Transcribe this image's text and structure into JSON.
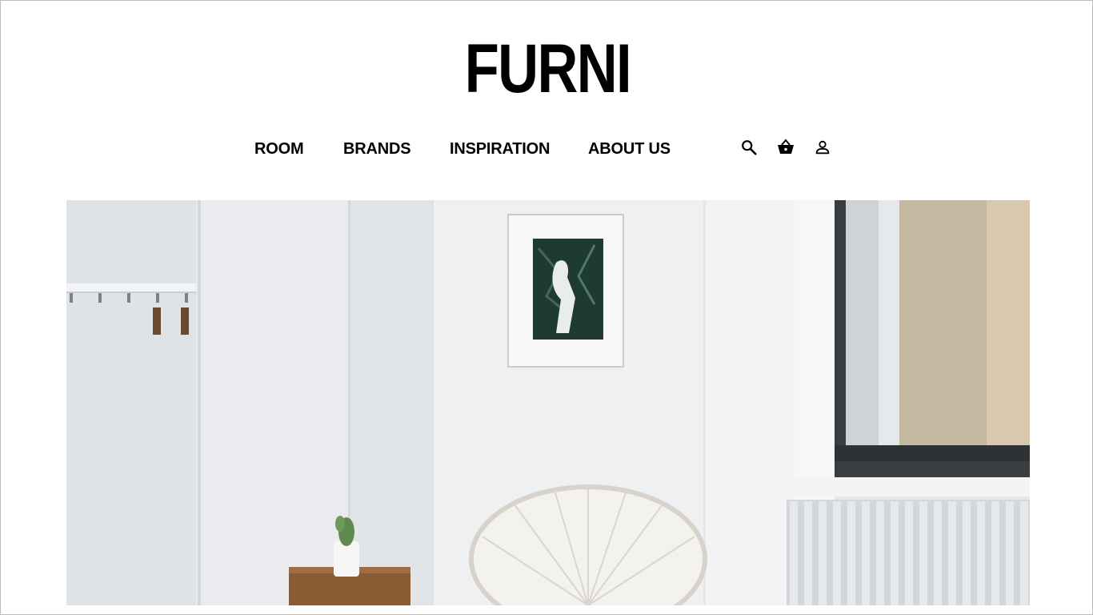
{
  "brand": {
    "logo_text": "FURNI"
  },
  "nav": {
    "items": [
      {
        "label": "ROOM"
      },
      {
        "label": "BRANDS"
      },
      {
        "label": "INSPIRATION"
      },
      {
        "label": "ABOUT US"
      }
    ]
  },
  "header_icons": {
    "search": "search-icon",
    "cart": "basket-icon",
    "account": "user-icon"
  },
  "hero": {
    "scene": "hero-room-image"
  },
  "colors": {
    "text": "#000000",
    "wall": "#e9ebee",
    "wood": "#8a5a33"
  }
}
